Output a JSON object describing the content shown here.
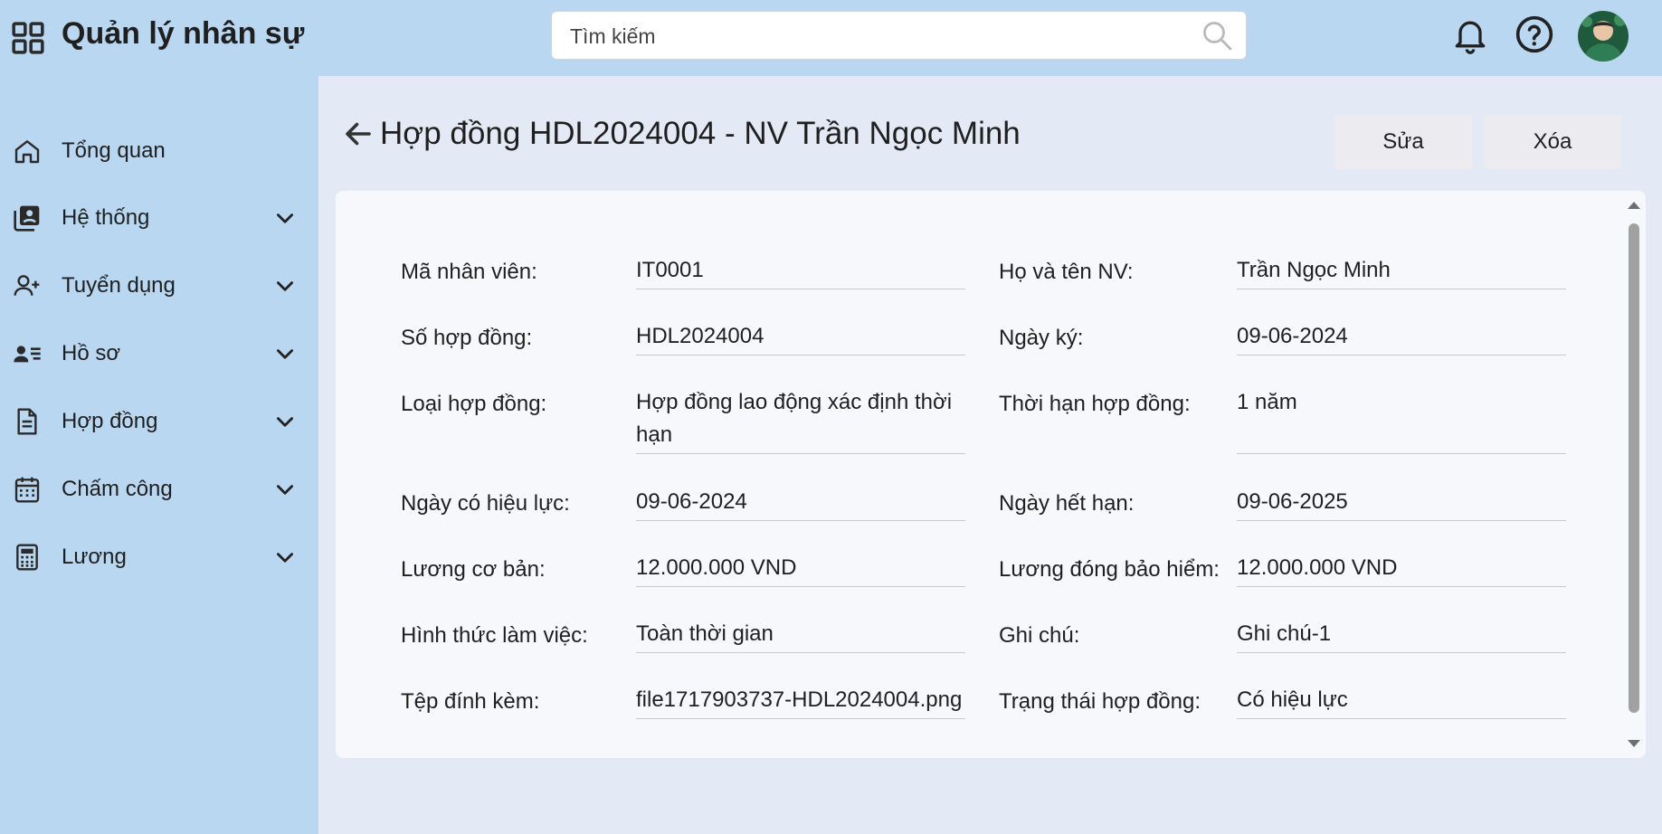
{
  "app": {
    "title": "Quản lý nhân sự"
  },
  "search": {
    "placeholder": "Tìm kiếm"
  },
  "sidebar": {
    "items": [
      {
        "label": "Tổng quan",
        "icon": "home-icon"
      },
      {
        "label": "Hệ thống",
        "icon": "system-icon"
      },
      {
        "label": "Tuyển dụng",
        "icon": "add-person-icon"
      },
      {
        "label": "Hồ sơ",
        "icon": "profile-list-icon"
      },
      {
        "label": "Hợp đồng",
        "icon": "document-icon"
      },
      {
        "label": "Chấm công",
        "icon": "calendar-icon"
      },
      {
        "label": "Lương",
        "icon": "calculator-icon"
      }
    ]
  },
  "page": {
    "title": "Hợp đồng HDL2024004 - NV Trần Ngọc Minh",
    "edit_label": "Sửa",
    "delete_label": "Xóa"
  },
  "fields": {
    "employee_id": {
      "label": "Mã nhân viên:",
      "value": "IT0001"
    },
    "employee_name": {
      "label": "Họ và tên NV:",
      "value": "Trần Ngọc Minh"
    },
    "contract_no": {
      "label": "Số hợp đồng:",
      "value": "HDL2024004"
    },
    "sign_date": {
      "label": "Ngày ký:",
      "value": "09-06-2024"
    },
    "contract_type": {
      "label": "Loại hợp đồng:",
      "value": "Hợp đồng lao động xác định thời hạn"
    },
    "contract_term": {
      "label": "Thời hạn hợp đồng:",
      "value": "1 năm"
    },
    "effective_date": {
      "label": "Ngày có hiệu lực:",
      "value": "09-06-2024"
    },
    "expiry_date": {
      "label": "Ngày hết hạn:",
      "value": "09-06-2025"
    },
    "base_salary": {
      "label": "Lương cơ bản:",
      "value": "12.000.000 VND"
    },
    "insurance_salary": {
      "label": "Lương đóng bảo hiểm:",
      "value": "12.000.000 VND"
    },
    "work_type": {
      "label": "Hình thức làm việc:",
      "value": "Toàn thời gian"
    },
    "note": {
      "label": "Ghi chú:",
      "value": "Ghi chú-1"
    },
    "attachment": {
      "label": "Tệp đính kèm:",
      "value": "file1717903737-HDL2024004.png"
    },
    "status": {
      "label": "Trạng thái hợp đồng:",
      "value": "Có hiệu lực"
    }
  },
  "colors": {
    "background": "#bad7f2",
    "main": "#e4e9f6",
    "card": "#f7f8fb",
    "button": "#ececf0"
  }
}
